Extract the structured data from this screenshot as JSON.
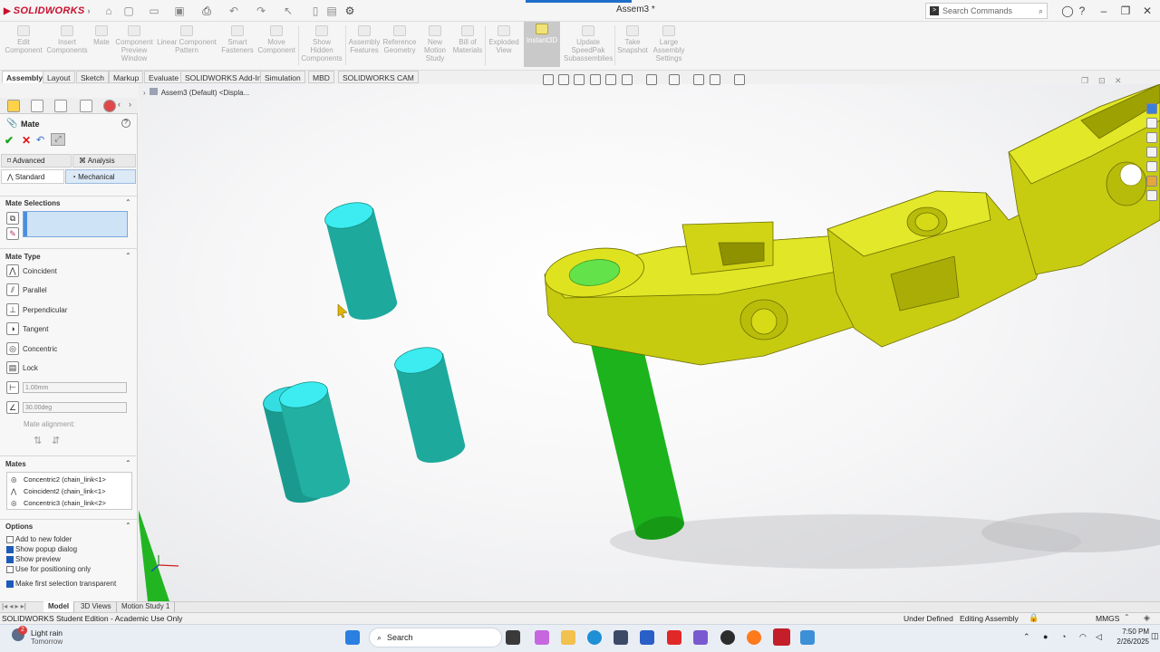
{
  "app": {
    "brand": "SOLIDWORKS",
    "doc_title": "Assem3 *"
  },
  "search": {
    "placeholder": "Search Commands"
  },
  "commands": [
    {
      "label": "Edit Component"
    },
    {
      "label": "Insert Components"
    },
    {
      "label": "Mate"
    },
    {
      "label": "Component Preview Window"
    },
    {
      "label": "Linear Component Pattern"
    },
    {
      "label": "Smart Fasteners"
    },
    {
      "label": "Move Component"
    },
    {
      "label": "Show Hidden Components"
    },
    {
      "label": "Assembly Features"
    },
    {
      "label": "Reference Geometry"
    },
    {
      "label": "New Motion Study"
    },
    {
      "label": "Bill of Materials"
    },
    {
      "label": "Exploded View"
    },
    {
      "label": "Instant3D"
    },
    {
      "label": "Update SpeedPak Subassemblies"
    },
    {
      "label": "Take Snapshot"
    },
    {
      "label": "Large Assembly Settings"
    }
  ],
  "tabs": [
    "Assembly",
    "Layout",
    "Sketch",
    "Markup",
    "Evaluate",
    "SOLIDWORKS Add-Ins",
    "Simulation",
    "MBD",
    "SOLIDWORKS CAM"
  ],
  "tree": {
    "root": "Assem3 (Default) <Displa..."
  },
  "mate_panel": {
    "title": "Mate",
    "tabs_top": {
      "advanced": "Advanced",
      "analysis": "Analysis"
    },
    "tabs_bottom": {
      "standard": "Standard",
      "mechanical": "Mechanical"
    },
    "mate_selections_title": "Mate Selections",
    "mate_type_title": "Mate Type",
    "mate_types": [
      "Coincident",
      "Parallel",
      "Perpendicular",
      "Tangent",
      "Concentric",
      "Lock"
    ],
    "distance_value": "1.00mm",
    "angle_value": "30.00deg",
    "mate_alignment_label": "Mate alignment:",
    "mates_title": "Mates",
    "mates": [
      "Concentric2 (chain_link<1>",
      "Coincident2 (chain_link<1>",
      "Concentric3 (chain_link<2>"
    ],
    "options_title": "Options",
    "options": [
      {
        "label": "Add to new folder",
        "checked": false
      },
      {
        "label": "Show popup dialog",
        "checked": true
      },
      {
        "label": "Show preview",
        "checked": true
      },
      {
        "label": "Use for positioning only",
        "checked": false
      },
      {
        "label": "Make first selection transparent",
        "checked": true
      }
    ]
  },
  "bottom_tabs": [
    "Model",
    "3D Views",
    "Motion Study 1"
  ],
  "status": {
    "edition": "SOLIDWORKS Student Edition - Academic Use Only",
    "state": "Under Defined",
    "mode": "Editing Assembly",
    "units": "MMGS"
  },
  "taskbar": {
    "weather": "Light rain",
    "weather_sub": "Tomorrow",
    "badge": "2",
    "search": "Search",
    "time": "7:50 PM",
    "date": "2/26/2025"
  },
  "colors": {
    "pin": "#27c1b4",
    "link": "#d8dc1a",
    "green_pin": "#1fbf1f"
  }
}
